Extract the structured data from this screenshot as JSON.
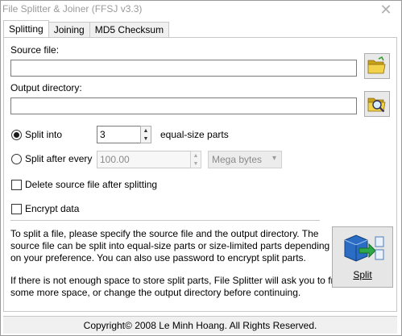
{
  "window": {
    "title": "File Splitter & Joiner (FFSJ v3.3)",
    "close_glyph": "✕"
  },
  "tabs": [
    {
      "label": "Splitting",
      "active": true
    },
    {
      "label": "Joining",
      "active": false
    },
    {
      "label": "MD5 Checksum",
      "active": false
    }
  ],
  "source": {
    "label": "Source file:",
    "value": "",
    "browse_icon": "folder-open-icon"
  },
  "output": {
    "label": "Output directory:",
    "value": "",
    "browse_icon": "folder-search-icon"
  },
  "split_into": {
    "label": "Split into",
    "selected": true,
    "count": "3",
    "suffix": "equal-size parts"
  },
  "split_after": {
    "label": "Split after every",
    "selected": false,
    "size": "100.00",
    "unit": "Mega bytes"
  },
  "options": {
    "delete_source": {
      "label": "Delete source file after splitting",
      "checked": false
    },
    "encrypt": {
      "label": "Encrypt data",
      "checked": false
    }
  },
  "info": {
    "p1": [
      "To split a file, please specify the source file and the output directory. The",
      "source file can be split into equal-size parts or size-limited parts depending",
      "on your preference. You can also use password to encrypt split parts."
    ],
    "p2": [
      "If there is not enough space to store split parts, File Splitter will ask you to free",
      "some more space, or change the output directory before continuing."
    ]
  },
  "split_button": {
    "label": "Split",
    "icon": "split-files-icon"
  },
  "footer": {
    "text": "Copyright© 2008 Le Minh Hoang. All Rights Reserved."
  },
  "colors": {
    "window_bg": "#ffffff",
    "panel_border": "#c8c8c8",
    "footer_bg": "#f0f0f0",
    "folder_yellow": "#e8c22a",
    "split_blue": "#2b6cc4"
  }
}
